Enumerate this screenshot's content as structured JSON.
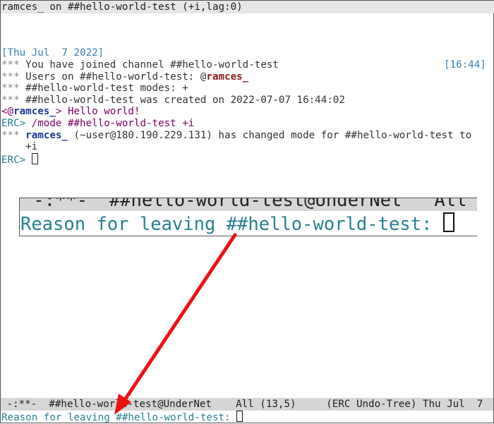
{
  "header": {
    "title": "ramces_ on ##hello-world-test (+i,lag:0)"
  },
  "buffer": {
    "date_stamp": "[Thu Jul  7 2022]",
    "time_stamp": "[16:44]",
    "lines": {
      "joined": {
        "prefix": "***",
        "text": " You have joined channel ##hello-world-test"
      },
      "users": {
        "prefix": "***",
        "text": " Users on ##hello-world-test: @",
        "nick": "ramces_"
      },
      "modes": {
        "prefix": "***",
        "text": " ##hello-world-test modes: +"
      },
      "created": {
        "prefix": "***",
        "text": " ##hello-world-test was created on 2022-07-07 16:44:02"
      },
      "message": {
        "open": "<@",
        "nick": "ramces_",
        "close": "> ",
        "text": "Hello world!"
      },
      "command": {
        "prompt": "ERC>",
        "text": " /mode ##hello-world-test +i"
      },
      "modechange": {
        "prefix": "***",
        "nick": "ramces_",
        "text": " (~user@180.190.229.131) has changed mode for ##hello-world-test to",
        "cont": "    +i"
      },
      "prompt": {
        "prompt": "ERC>"
      }
    }
  },
  "modeline": {
    "text": " -:**-  ##hello-world-test@UnderNet    All (13,5)     (ERC Undo-Tree) Thu Jul  7"
  },
  "minibuffer": {
    "prompt": "Reason for leaving ##hello-world-test: "
  },
  "callout": {
    "modeline": " -:**-  ##hello-world-test@UnderNet   All",
    "prompt": "Reason for leaving ##hello-world-test: "
  },
  "colors": {
    "arrow": "#ee1111",
    "minibuffer": "#2a7f8f"
  }
}
